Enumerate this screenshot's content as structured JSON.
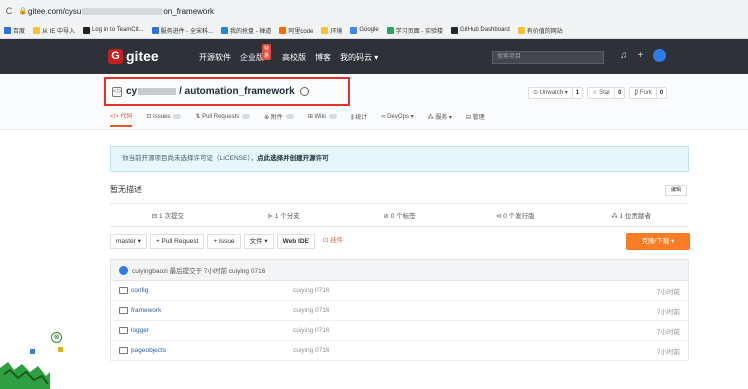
{
  "browser": {
    "nav_icon": "reload-icon",
    "url_prefix": "gitee.com/cysu",
    "url_suffix": "on_framework"
  },
  "bookmarks": [
    {
      "label": "百度",
      "color": "#2f6fe0"
    },
    {
      "label": "从 IE 中导入",
      "color": "#f5c03a"
    },
    {
      "label": "Log in to TeamCit...",
      "color": "#222222"
    },
    {
      "label": "服务进件 - 全宋科...",
      "color": "#2f6fe0"
    },
    {
      "label": "我的抢盘 - 禅道",
      "color": "#1e88e5"
    },
    {
      "label": "阿里code",
      "color": "#ff6a00"
    },
    {
      "label": "环境",
      "color": "#f5c03a"
    },
    {
      "label": "Google",
      "color": "#4285f4"
    },
    {
      "label": "学习页面 - 实验楼",
      "color": "#26a65b"
    },
    {
      "label": "GitHub Dashboard",
      "color": "#24292e"
    },
    {
      "label": "有价值的网站",
      "color": "#f5c03a"
    }
  ],
  "topnav": {
    "logo_letter": "G",
    "logo_text": "gitee",
    "links": [
      "开源软件",
      "企业版",
      "高校版",
      "博客",
      "我的码云 ▾"
    ],
    "badge": "特惠",
    "search_placeholder": "搜索项目"
  },
  "repo": {
    "icon": "</>",
    "owner_prefix": "cy",
    "title": "/ automation_framework",
    "buttons": [
      {
        "label": "⊙ Unwatch ▾",
        "count": "1"
      },
      {
        "label": "☆ Star",
        "count": "0"
      },
      {
        "label": "Ƿ Fork",
        "count": "0"
      }
    ]
  },
  "tabs": [
    "</> 代码",
    "⊡ Issues",
    "⇅ Pull Requests",
    "⊕ 附件",
    "⊞ Wiki",
    "⫼ 统计",
    "∞ DevOps ▾",
    "⁂ 服务 ▾",
    "⊟ 管理"
  ],
  "license": {
    "text": "你当前开源项目尚未选择许可证（LICENSE），",
    "link": "点此选择并创建开源许可"
  },
  "description": {
    "text": "暂无描述",
    "edit_label": "编辑"
  },
  "stats": [
    "⊟ 1 次提交",
    "⊱ 1 个分支",
    "⊘ 0 个标签",
    "⊲ 0 个发行版",
    "⁂ 1 位贡献者"
  ],
  "toolbar": {
    "branch": "master ▾",
    "pull_request": "+ Pull Request",
    "issue": "+ Issue",
    "file": "文件 ▾",
    "webide": "Web IDE",
    "attach": "挂件",
    "clone": "克隆/下载 ▾"
  },
  "commit": {
    "text": "cuiyingbaozi 最后提交于 7小时前 cuiying 0716"
  },
  "files": [
    {
      "name": "config",
      "commit": "cuiying 0716",
      "time": "7小时前"
    },
    {
      "name": "framework",
      "commit": "cuiying 0716",
      "time": "7小时前"
    },
    {
      "name": "logger",
      "commit": "cuiying 0716",
      "time": "7小时前"
    },
    {
      "name": "pageobjects",
      "commit": "cuiying 0716",
      "time": "7小时前"
    }
  ],
  "float_icon": "⊗"
}
